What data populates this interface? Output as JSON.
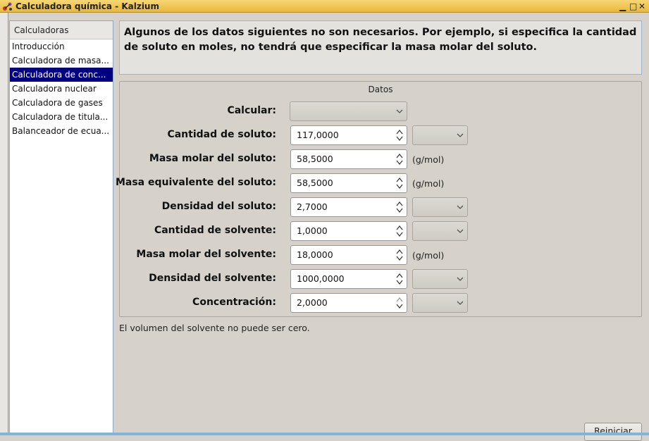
{
  "window": {
    "title": "Calculadora química - Kalzium",
    "icon": "kalzium-app-icon",
    "controls": [
      "minimize-icon",
      "maximize-icon",
      "close-icon"
    ]
  },
  "sidebar": {
    "header": "Calculadoras",
    "items": [
      {
        "label": "Introducción",
        "selected": false
      },
      {
        "label": "Calculadora de masa...",
        "selected": false
      },
      {
        "label": "Calculadora de conc...",
        "selected": true
      },
      {
        "label": "Calculadora nuclear",
        "selected": false
      },
      {
        "label": "Calculadora de gases",
        "selected": false
      },
      {
        "label": "Calculadora de titula...",
        "selected": false
      },
      {
        "label": "Balanceador de ecua...",
        "selected": false
      }
    ]
  },
  "info": {
    "text": "Algunos de los datos siguientes no son necesarios. Por ejemplo, si especifica la cantidad de soluto en moles, no tendrá que especificar la masa molar del soluto."
  },
  "group": {
    "title": "Datos",
    "fields": {
      "calculate": {
        "label": "Calcular:",
        "value": ""
      },
      "solute_amount": {
        "label": "Cantidad de soluto:",
        "value": "117,0000",
        "unit": ""
      },
      "solute_molar_mass": {
        "label": "Masa molar del soluto:",
        "value": "58,5000",
        "unit": "(g/mol)"
      },
      "solute_eq_mass": {
        "label": "Masa equivalente del soluto:",
        "value": "58,5000",
        "unit": "(g/mol)"
      },
      "solute_density": {
        "label": "Densidad del soluto:",
        "value": "2,7000",
        "unit": ""
      },
      "solvent_amount": {
        "label": "Cantidad de solvente:",
        "value": "1,0000",
        "unit": ""
      },
      "solvent_molar_mass": {
        "label": "Masa molar del solvente:",
        "value": "18,0000",
        "unit": "(g/mol)"
      },
      "solvent_density": {
        "label": "Densidad del solvente:",
        "value": "1000,0000",
        "unit": ""
      },
      "concentration": {
        "label": "Concentración:",
        "value": "2,0000",
        "unit": ""
      }
    }
  },
  "status": {
    "message": "El volumen del solvente no puede ser cero."
  },
  "buttons": {
    "reset": "Reiniciar"
  },
  "colors": {
    "titlebar": "#e9b83a",
    "selection": "#000080"
  }
}
